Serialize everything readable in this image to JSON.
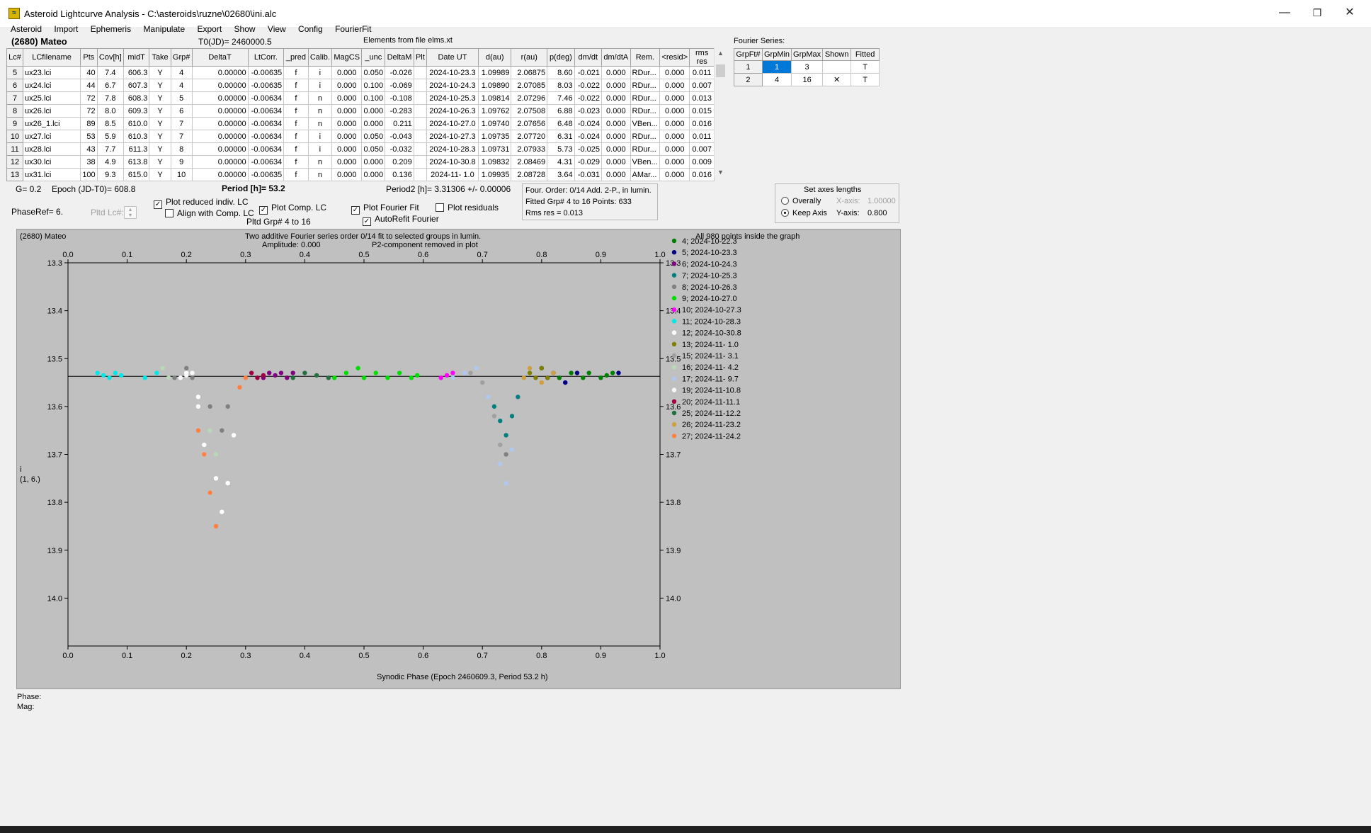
{
  "window": {
    "title": "Asteroid Lightcurve Analysis - C:\\asteroids\\ruzne\\02680\\ini.alc",
    "minimize": "—",
    "maximize": "❐",
    "close": "✕"
  },
  "menu": [
    "Asteroid",
    "Import",
    "Ephemeris",
    "Manipulate",
    "Export",
    "Show",
    "View",
    "Config",
    "FourierFit"
  ],
  "header": {
    "asteroid": "(2680) Mateo",
    "t0": "T0(JD)= 2460000.5",
    "elements": "Elements from file elms.xt"
  },
  "lc_table": {
    "columns": [
      "Lc#",
      "LCfilename",
      "Pts",
      "Cov[h]",
      "midT",
      "Take",
      "Grp#",
      "DeltaT",
      "LtCorr.",
      "_pred",
      "Calib.",
      "MagCS",
      "_unc",
      "DeltaM",
      "Plt",
      "Date UT",
      "d(au)",
      "r(au)",
      "p(deg)",
      "dm/dt",
      "dm/dtA",
      "Rem.",
      "<resid>",
      "rms res"
    ],
    "rows": [
      [
        "5",
        "ux23.lci",
        "40",
        "7.4",
        "606.3",
        "Y",
        "4",
        "0.00000",
        "-0.00635",
        "f",
        "i",
        "0.000",
        "0.050",
        "-0.026",
        "",
        "2024-10-23.3",
        "1.09989",
        "2.06875",
        "8.60",
        "-0.021",
        "0.000",
        "RDur...",
        "0.000",
        "0.011"
      ],
      [
        "6",
        "ux24.lci",
        "44",
        "6.7",
        "607.3",
        "Y",
        "4",
        "0.00000",
        "-0.00635",
        "f",
        "i",
        "0.000",
        "0.100",
        "-0.069",
        "",
        "2024-10-24.3",
        "1.09890",
        "2.07085",
        "8.03",
        "-0.022",
        "0.000",
        "RDur...",
        "0.000",
        "0.007"
      ],
      [
        "7",
        "ux25.lci",
        "72",
        "7.8",
        "608.3",
        "Y",
        "5",
        "0.00000",
        "-0.00634",
        "f",
        "n",
        "0.000",
        "0.100",
        "-0.108",
        "",
        "2024-10-25.3",
        "1.09814",
        "2.07296",
        "7.46",
        "-0.022",
        "0.000",
        "RDur...",
        "0.000",
        "0.013"
      ],
      [
        "8",
        "ux26.lci",
        "72",
        "8.0",
        "609.3",
        "Y",
        "6",
        "0.00000",
        "-0.00634",
        "f",
        "n",
        "0.000",
        "0.000",
        "-0.283",
        "",
        "2024-10-26.3",
        "1.09762",
        "2.07508",
        "6.88",
        "-0.023",
        "0.000",
        "RDur...",
        "0.000",
        "0.015"
      ],
      [
        "9",
        "ux26_1.lci",
        "89",
        "8.5",
        "610.0",
        "Y",
        "7",
        "0.00000",
        "-0.00634",
        "f",
        "n",
        "0.000",
        "0.000",
        "0.211",
        "",
        "2024-10-27.0",
        "1.09740",
        "2.07656",
        "6.48",
        "-0.024",
        "0.000",
        "VBen...",
        "0.000",
        "0.016"
      ],
      [
        "10",
        "ux27.lci",
        "53",
        "5.9",
        "610.3",
        "Y",
        "7",
        "0.00000",
        "-0.00634",
        "f",
        "i",
        "0.000",
        "0.050",
        "-0.043",
        "",
        "2024-10-27.3",
        "1.09735",
        "2.07720",
        "6.31",
        "-0.024",
        "0.000",
        "RDur...",
        "0.000",
        "0.011"
      ],
      [
        "11",
        "ux28.lci",
        "43",
        "7.7",
        "611.3",
        "Y",
        "8",
        "0.00000",
        "-0.00634",
        "f",
        "i",
        "0.000",
        "0.050",
        "-0.032",
        "",
        "2024-10-28.3",
        "1.09731",
        "2.07933",
        "5.73",
        "-0.025",
        "0.000",
        "RDur...",
        "0.000",
        "0.007"
      ],
      [
        "12",
        "ux30.lci",
        "38",
        "4.9",
        "613.8",
        "Y",
        "9",
        "0.00000",
        "-0.00634",
        "f",
        "n",
        "0.000",
        "0.000",
        "0.209",
        "",
        "2024-10-30.8",
        "1.09832",
        "2.08469",
        "4.31",
        "-0.029",
        "0.000",
        "VBen...",
        "0.000",
        "0.009"
      ],
      [
        "13",
        "ux31.lci",
        "100",
        "9.3",
        "615.0",
        "Y",
        "10",
        "0.00000",
        "-0.00635",
        "f",
        "n",
        "0.000",
        "0.000",
        "0.136",
        "",
        "2024-11- 1.0",
        "1.09935",
        "2.08728",
        "3.64",
        "-0.031",
        "0.000",
        "AMar...",
        "0.000",
        "0.016"
      ]
    ]
  },
  "fourier_series": {
    "title": "Fourier Series:",
    "columns": [
      "GrpFt#",
      "GrpMin",
      "GrpMax",
      "Shown",
      "Fitted"
    ],
    "rows": [
      [
        "1",
        "1",
        "3",
        "",
        "T"
      ],
      [
        "2",
        "4",
        "16",
        "✕",
        "T"
      ]
    ]
  },
  "controls": {
    "g": "G= 0.2",
    "epoch": "Epoch (JD-T0)= 608.8",
    "period": "Period [h]= 53.2",
    "period2": "Period2 [h]= 3.31306 +/- 0.00006",
    "phase_ref": "PhaseRef= 6.",
    "pltd_lc": "Pltd Lc#:",
    "plot_reduced": "Plot reduced indiv. LC",
    "align_comp": "Align with Comp. LC",
    "plot_comp": "Plot Comp. LC",
    "pltd_grp": "Pltd Grp#  4   to   16",
    "plot_fourier": "Plot Fourier Fit",
    "autorefit": "AutoRefit Fourier",
    "plot_residuals": "Plot residuals",
    "four_order": "Four. Order:  0/14    Add. 2-P., in lumin.",
    "fitted_grp": "Fitted Grp# 4 to 16      Points: 633",
    "rms_res": "Rms res      = 0.013",
    "axes_title": "Set axes lengths",
    "overally": "Overally",
    "x_axis_label": "X-axis:",
    "x_axis_value": "1.00000",
    "keep_axis": "Keep Axis",
    "y_axis_label": "Y-axis:",
    "y_axis_value": "0.800"
  },
  "plot": {
    "name": "(2680) Mateo",
    "subtitle1": "Two additive Fourier series order 0/14 fit to selected groups in lumin.",
    "amplitude": "Amplitude: 0.000",
    "p2_note": "P2-component removed in plot",
    "points_note": "All 980 points inside the graph",
    "ylabel_top": "i",
    "ylabel_bottom": "(1, 6.)",
    "xlabel": "Synodic Phase (Epoch 2460609.3, Period 53.2 h)",
    "phase_label": "Phase:",
    "mag_label": "Mag:"
  },
  "chart_data": {
    "type": "scatter",
    "xlim": [
      0.0,
      1.0
    ],
    "ylim": [
      13.3,
      14.1
    ],
    "y_inverted": true,
    "grid": false,
    "legend_position": "right",
    "x_ticks": [
      "0.0",
      "0.1",
      "0.2",
      "0.3",
      "0.4",
      "0.5",
      "0.6",
      "0.7",
      "0.8",
      "0.9",
      "1.0"
    ],
    "y_ticks": [
      "13.3",
      "13.4",
      "13.5",
      "13.6",
      "13.7",
      "13.8",
      "13.9",
      "14.0"
    ],
    "fit_line": {
      "y": 13.537,
      "color": "#000000"
    },
    "series": [
      {
        "name": "4; 2024-10-22.3",
        "color": "#008000",
        "points": [
          [
            0.83,
            13.54
          ],
          [
            0.85,
            13.53
          ],
          [
            0.87,
            13.54
          ],
          [
            0.88,
            13.53
          ],
          [
            0.9,
            13.54
          ],
          [
            0.91,
            13.535
          ],
          [
            0.92,
            13.53
          ]
        ]
      },
      {
        "name": "5; 2024-10-23.3",
        "color": "#000080",
        "points": [
          [
            0.8,
            13.52
          ],
          [
            0.81,
            13.54
          ],
          [
            0.82,
            13.53
          ],
          [
            0.84,
            13.55
          ],
          [
            0.86,
            13.53
          ],
          [
            0.93,
            13.53
          ]
        ]
      },
      {
        "name": "6; 2024-10-24.3",
        "color": "#800080",
        "points": [
          [
            0.33,
            13.54
          ],
          [
            0.34,
            13.53
          ],
          [
            0.35,
            13.535
          ],
          [
            0.36,
            13.53
          ],
          [
            0.37,
            13.54
          ],
          [
            0.38,
            13.53
          ]
        ]
      },
      {
        "name": "7; 2024-10-25.3",
        "color": "#008080",
        "points": [
          [
            0.72,
            13.6
          ],
          [
            0.73,
            13.63
          ],
          [
            0.74,
            13.66
          ],
          [
            0.75,
            13.62
          ],
          [
            0.76,
            13.58
          ]
        ]
      },
      {
        "name": "8; 2024-10-26.3",
        "color": "#808080",
        "points": [
          [
            0.18,
            13.54
          ],
          [
            0.2,
            13.52
          ],
          [
            0.21,
            13.54
          ],
          [
            0.24,
            13.6
          ],
          [
            0.26,
            13.65
          ],
          [
            0.27,
            13.6
          ],
          [
            0.74,
            13.7
          ]
        ]
      },
      {
        "name": "9; 2024-10-27.0",
        "color": "#00e000",
        "points": [
          [
            0.45,
            13.54
          ],
          [
            0.47,
            13.53
          ],
          [
            0.49,
            13.52
          ],
          [
            0.5,
            13.54
          ],
          [
            0.52,
            13.53
          ],
          [
            0.54,
            13.54
          ],
          [
            0.56,
            13.53
          ],
          [
            0.58,
            13.54
          ],
          [
            0.59,
            13.535
          ]
        ]
      },
      {
        "name": "10; 2024-10-27.3",
        "color": "#ff00ff",
        "points": [
          [
            0.63,
            13.54
          ],
          [
            0.64,
            13.535
          ],
          [
            0.65,
            13.53
          ]
        ]
      },
      {
        "name": "11; 2024-10-28.3",
        "color": "#00e8e8",
        "points": [
          [
            0.05,
            13.53
          ],
          [
            0.06,
            13.535
          ],
          [
            0.07,
            13.54
          ],
          [
            0.08,
            13.53
          ],
          [
            0.09,
            13.535
          ],
          [
            0.13,
            13.54
          ],
          [
            0.15,
            13.53
          ]
        ]
      },
      {
        "name": "12; 2024-10-30.8",
        "color": "#ffffff",
        "points": [
          [
            0.2,
            13.53
          ],
          [
            0.22,
            13.58
          ],
          [
            0.23,
            13.68
          ],
          [
            0.25,
            13.75
          ],
          [
            0.26,
            13.82
          ],
          [
            0.27,
            13.76
          ],
          [
            0.28,
            13.66
          ]
        ]
      },
      {
        "name": "13; 2024-11- 1.0",
        "color": "#808000",
        "points": [
          [
            0.78,
            13.53
          ],
          [
            0.79,
            13.54
          ],
          [
            0.8,
            13.52
          ],
          [
            0.81,
            13.54
          ]
        ]
      },
      {
        "name": "15; 2024-11- 3.1",
        "color": "#a0a0a0",
        "points": [
          [
            0.68,
            13.53
          ],
          [
            0.7,
            13.55
          ],
          [
            0.72,
            13.62
          ],
          [
            0.73,
            13.68
          ]
        ]
      },
      {
        "name": "16; 2024-11- 4.2",
        "color": "#b8d8b8",
        "points": [
          [
            0.16,
            13.52
          ],
          [
            0.17,
            13.54
          ],
          [
            0.24,
            13.65
          ],
          [
            0.25,
            13.7
          ]
        ]
      },
      {
        "name": "17; 2024-11- 9.7",
        "color": "#b0c8f0",
        "points": [
          [
            0.65,
            13.54
          ],
          [
            0.67,
            13.53
          ],
          [
            0.69,
            13.52
          ],
          [
            0.71,
            13.58
          ],
          [
            0.73,
            13.72
          ],
          [
            0.74,
            13.76
          ],
          [
            0.75,
            13.69
          ]
        ]
      },
      {
        "name": "19; 2024-11-10.8",
        "color": "#f8f8f8",
        "points": [
          [
            0.19,
            13.54
          ],
          [
            0.2,
            13.535
          ],
          [
            0.21,
            13.53
          ],
          [
            0.22,
            13.6
          ],
          [
            0.23,
            13.7
          ],
          [
            0.24,
            13.78
          ]
        ]
      },
      {
        "name": "20; 2024-11-11.1",
        "color": "#a00040",
        "points": [
          [
            0.31,
            13.53
          ],
          [
            0.32,
            13.54
          ],
          [
            0.33,
            13.535
          ]
        ]
      },
      {
        "name": "25; 2024-11-12.2",
        "color": "#207040",
        "points": [
          [
            0.38,
            13.54
          ],
          [
            0.4,
            13.53
          ],
          [
            0.42,
            13.535
          ],
          [
            0.44,
            13.54
          ]
        ]
      },
      {
        "name": "26; 2024-11-23.2",
        "color": "#d0a040",
        "points": [
          [
            0.77,
            13.54
          ],
          [
            0.78,
            13.52
          ],
          [
            0.8,
            13.55
          ],
          [
            0.82,
            13.53
          ]
        ]
      },
      {
        "name": "27; 2024-11-24.2",
        "color": "#ff8040",
        "points": [
          [
            0.22,
            13.65
          ],
          [
            0.23,
            13.7
          ],
          [
            0.24,
            13.78
          ],
          [
            0.25,
            13.85
          ],
          [
            0.29,
            13.56
          ],
          [
            0.3,
            13.54
          ]
        ]
      }
    ]
  },
  "colors": {
    "plot_bg": "#c0c0c0",
    "window_bg": "#f0f0f0",
    "selection": "#0078d7"
  }
}
